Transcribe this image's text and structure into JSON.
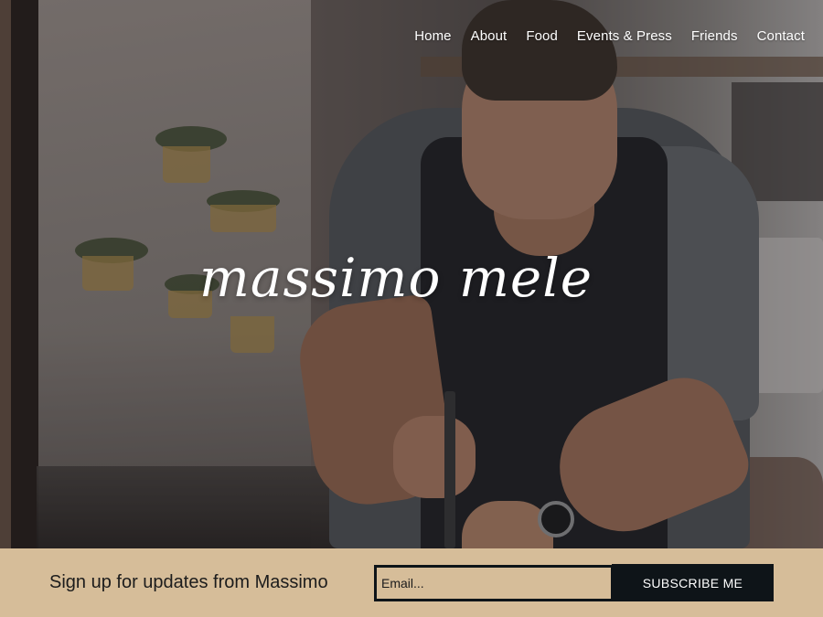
{
  "nav": {
    "items": [
      "Home",
      "About",
      "Food",
      "Events & Press",
      "Friends",
      "Contact"
    ]
  },
  "hero": {
    "logo_text": "massimo mele"
  },
  "signup": {
    "title": "Sign up for updates from Massimo",
    "email_placeholder": "Email...",
    "button_label": "SUBSCRIBE ME"
  },
  "colors": {
    "signup_bg": "#d6bd99",
    "button_bg": "#0e1418",
    "nav_text": "#ffffff"
  }
}
